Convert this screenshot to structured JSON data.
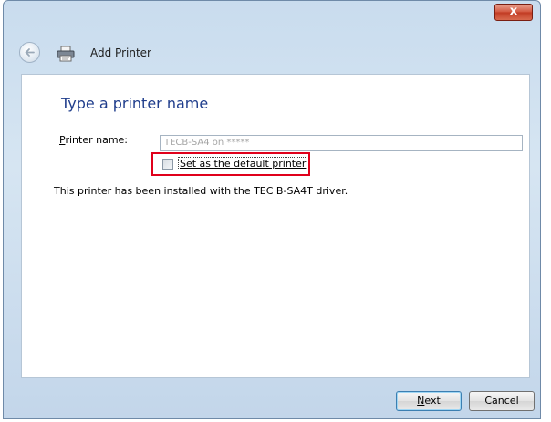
{
  "window": {
    "close_label": "x"
  },
  "nav": {
    "title": "Add Printer"
  },
  "page": {
    "heading": "Type a printer name",
    "printer_name_label_first": "P",
    "printer_name_label_rest": "rinter name:",
    "printer_name_value": "TECB-SA4 on *****",
    "default_checkbox_label": "Set as the default printer",
    "default_checked": false,
    "info_text": "This printer has been installed with the TEC B-SA4T driver."
  },
  "buttons": {
    "next_first": "N",
    "next_rest": "ext",
    "cancel": "Cancel"
  },
  "colors": {
    "heading": "#1f3d8c",
    "highlight_box": "#e0001b",
    "close_button": "#c13a22"
  },
  "icons": {
    "back": "back-arrow-icon",
    "printer": "printer-icon",
    "close": "close-icon"
  }
}
